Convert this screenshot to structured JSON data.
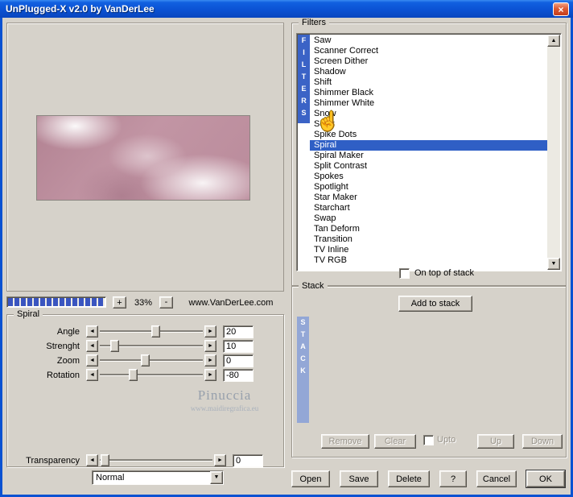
{
  "window": {
    "title": "UnPlugged-X v2.0 by VanDerLee",
    "close": "×"
  },
  "icons": {
    "arrow_left": "◄",
    "arrow_right": "►",
    "arrow_up": "▲",
    "arrow_down": "▼",
    "pointer": "☝"
  },
  "preview": {
    "zoom_in": "+",
    "zoom_out": "-",
    "zoom_level": "33%",
    "website": "www.VanDerLee.com"
  },
  "watermark": {
    "name": "Pinuccia",
    "url": "www.maidiregrafica.eu"
  },
  "filters": {
    "group_label": "Filters",
    "strip": "FILTERS",
    "items": [
      "Saw",
      "Scanner Correct",
      "Screen Dither",
      "Shadow",
      "Shift",
      "Shimmer Black",
      "Shimmer White",
      "Snow",
      "Solar",
      "Spike Dots",
      "Spiral",
      "Spiral Maker",
      "Split Contrast",
      "Spokes",
      "Spotlight",
      "Star Maker",
      "Starchart",
      "Swap",
      "Tan Deform",
      "Transition",
      "TV Inline",
      "TV RGB"
    ],
    "selected_index": 10,
    "selected": "Spiral",
    "on_top_label": "On top of stack"
  },
  "spiral": {
    "group_label": "Spiral",
    "params": [
      {
        "label": "Angle",
        "value": "20",
        "thumb_pct": 50
      },
      {
        "label": "Strenght",
        "value": "10",
        "thumb_pct": 10
      },
      {
        "label": "Zoom",
        "value": "0",
        "thumb_pct": 40
      },
      {
        "label": "Rotation",
        "value": "-80",
        "thumb_pct": 28
      }
    ],
    "transparency": {
      "label": "Transparency",
      "value": "0",
      "thumb_pct": 1
    },
    "blend_mode": "Normal"
  },
  "stack": {
    "group_label": "Stack",
    "strip": "STACK",
    "add_button": "Add to stack",
    "remove_button": "Remove",
    "clear_button": "Clear",
    "upto_label": "Upto",
    "up_button": "Up",
    "down_button": "Down"
  },
  "footer": {
    "open": "Open",
    "save": "Save",
    "delete": "Delete",
    "help": "?",
    "cancel": "Cancel",
    "ok": "OK"
  },
  "colors": {
    "selection": "#2F5FC5",
    "filters_strip": "#3B63C6",
    "stack_strip": "#93A7D6",
    "progress": "#3A55C0",
    "title_blue": "#0A52D2"
  }
}
